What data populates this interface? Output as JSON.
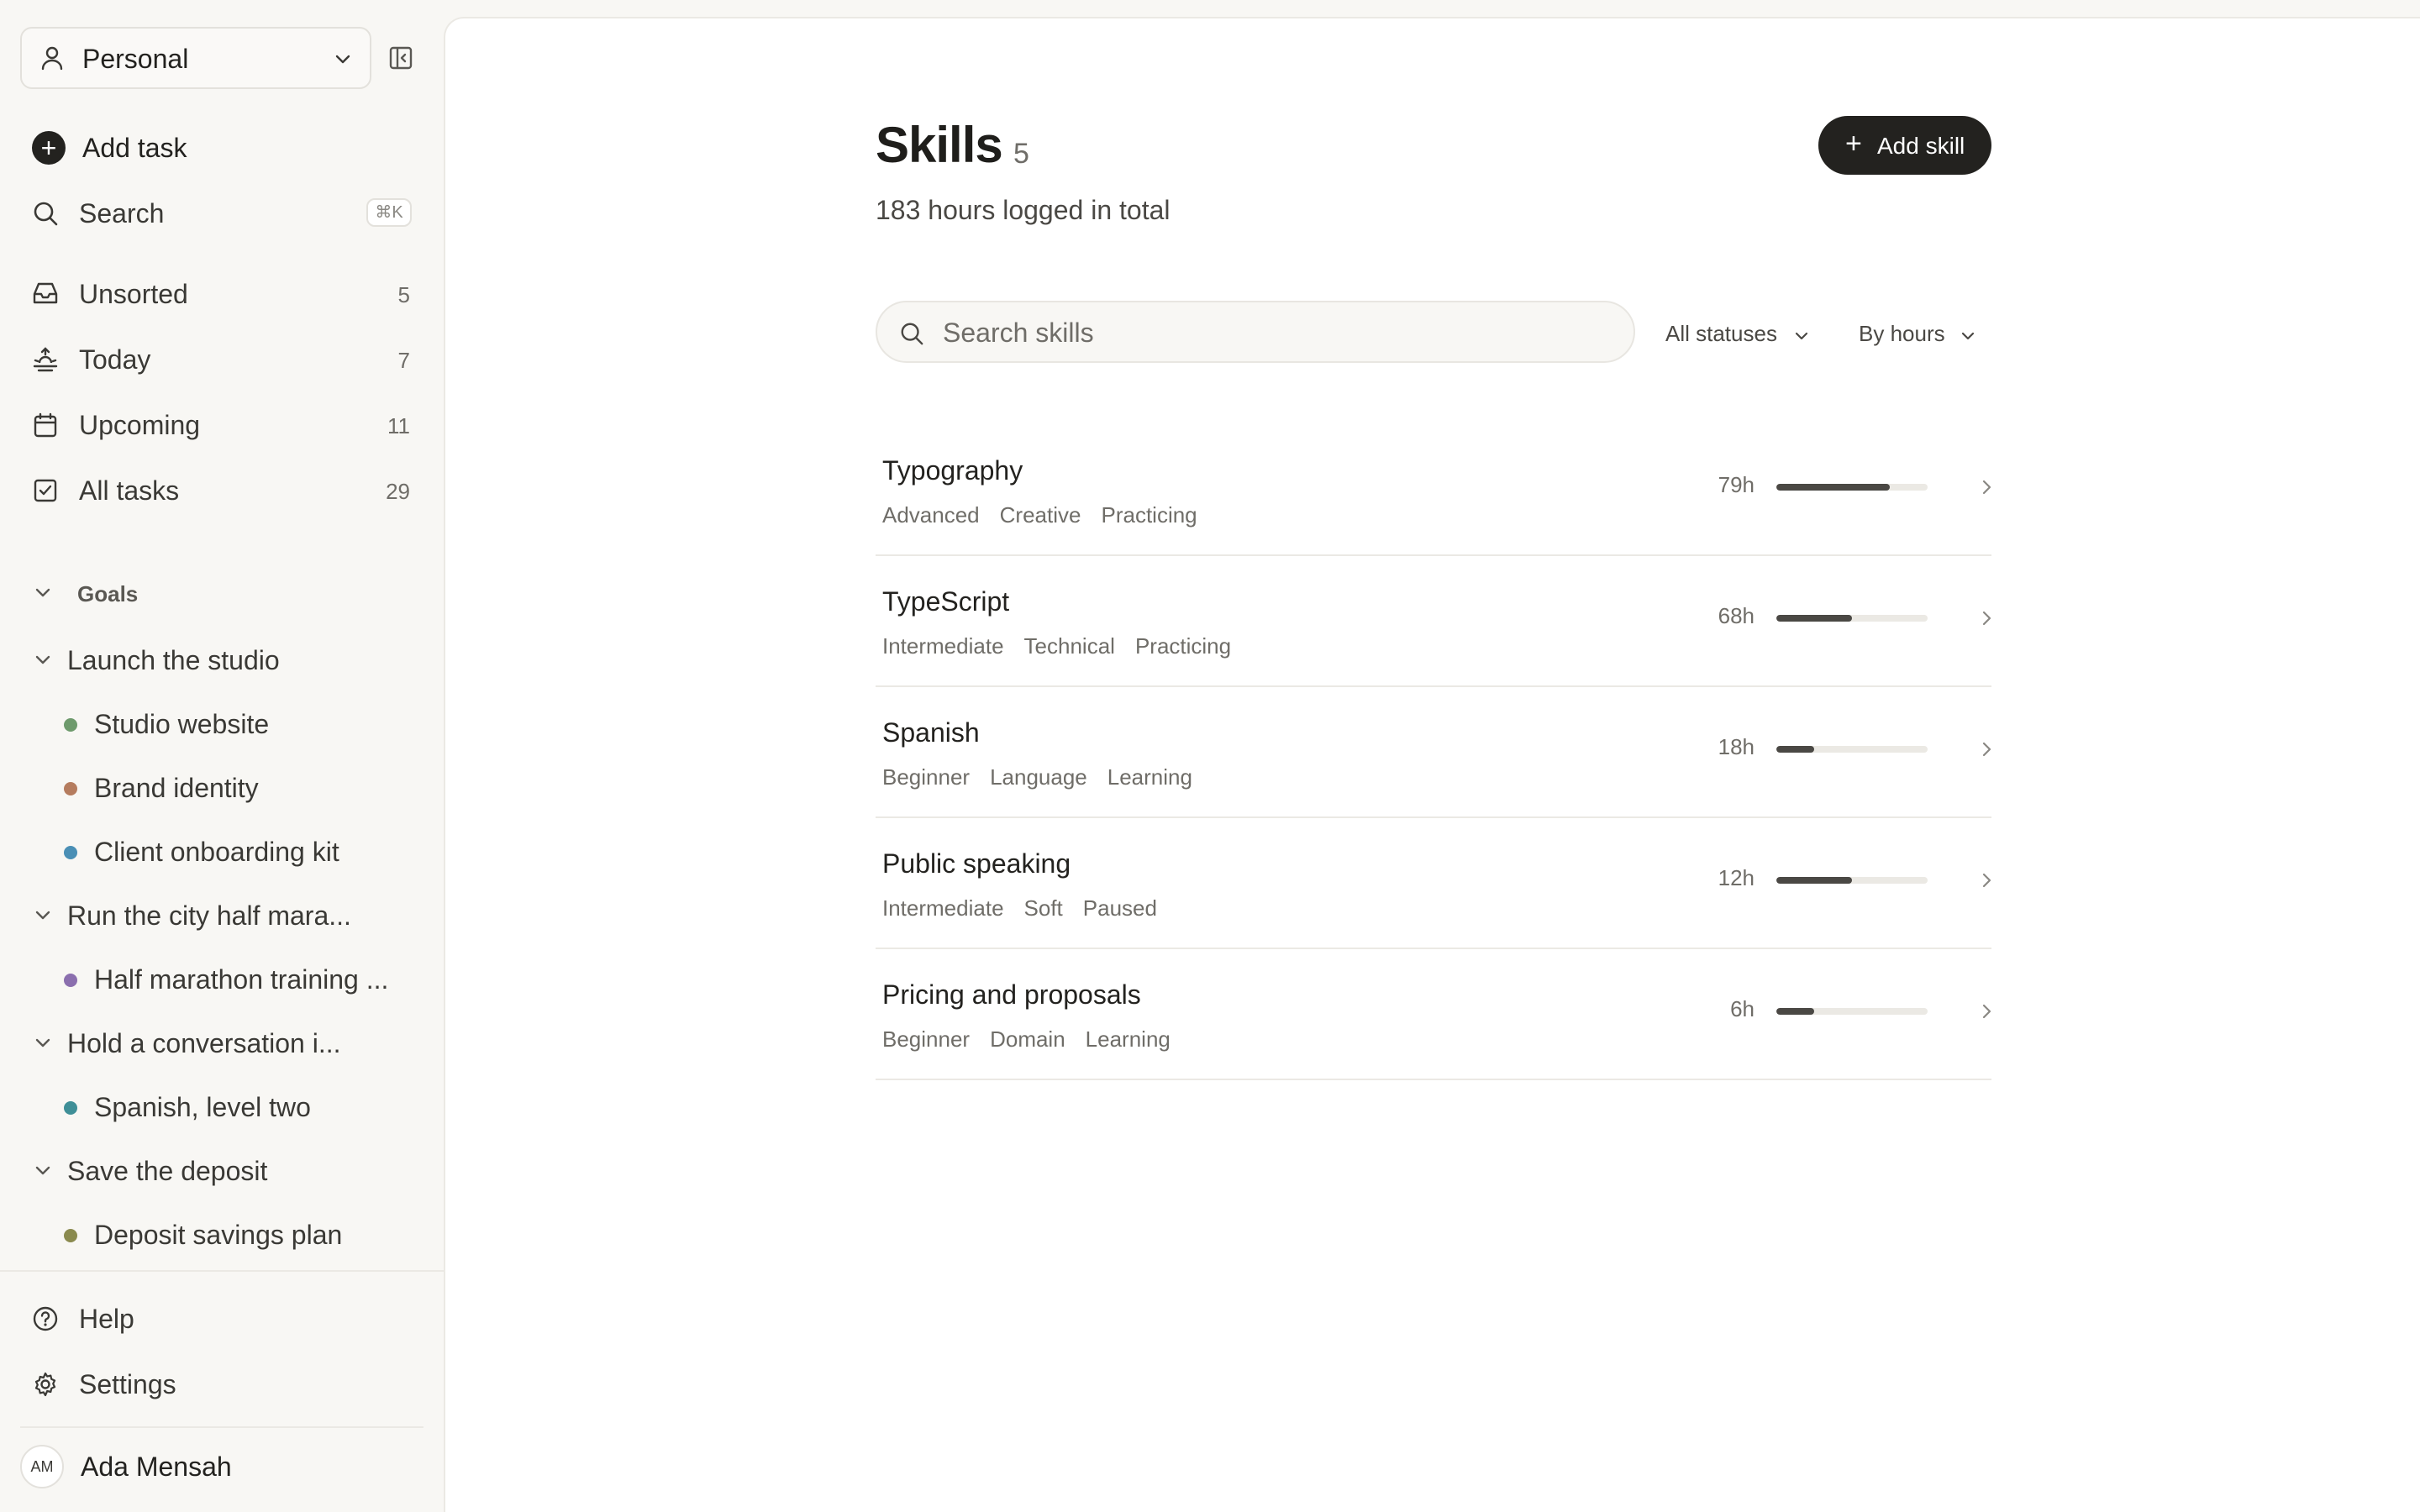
{
  "sidebar": {
    "workspace": {
      "name": "Personal"
    },
    "add_task": {
      "label": "Add task"
    },
    "search": {
      "label": "Search",
      "shortcut": "⌘K"
    },
    "nav": [
      {
        "label": "Unsorted",
        "count": "5",
        "icon": "inbox-icon"
      },
      {
        "label": "Today",
        "count": "7",
        "icon": "sunrise-icon"
      },
      {
        "label": "Upcoming",
        "count": "11",
        "icon": "calendar-icon"
      },
      {
        "label": "All tasks",
        "count": "29",
        "icon": "checkbox-icon"
      }
    ],
    "goals_header": "Goals",
    "goals": [
      {
        "label": "Launch the studio",
        "projects": [
          {
            "label": "Studio website",
            "color": "#6e9a6c"
          },
          {
            "label": "Brand identity",
            "color": "#b57c5e"
          },
          {
            "label": "Client onboarding kit",
            "color": "#4a8fb5"
          }
        ]
      },
      {
        "label": "Run the city half mara...",
        "projects": [
          {
            "label": "Half marathon training ...",
            "color": "#8b6fae"
          }
        ]
      },
      {
        "label": "Hold a conversation i...",
        "projects": [
          {
            "label": "Spanish, level two",
            "color": "#3f8f97"
          }
        ]
      },
      {
        "label": "Save the deposit",
        "projects": [
          {
            "label": "Deposit savings plan",
            "color": "#8a8a4e"
          }
        ]
      }
    ],
    "help": "Help",
    "settings": "Settings",
    "user": {
      "initials": "AM",
      "name": "Ada Mensah"
    }
  },
  "main": {
    "title": "Skills",
    "count": "5",
    "subtitle": "183 hours logged in total",
    "add_button": "Add skill",
    "search_placeholder": "Search skills",
    "filter_status": "All statuses",
    "sort": "By hours",
    "skills": [
      {
        "name": "Typography",
        "tags": [
          "Advanced",
          "Creative",
          "Practicing"
        ],
        "hours": "79h",
        "progress": 0.75
      },
      {
        "name": "TypeScript",
        "tags": [
          "Intermediate",
          "Technical",
          "Practicing"
        ],
        "hours": "68h",
        "progress": 0.5
      },
      {
        "name": "Spanish",
        "tags": [
          "Beginner",
          "Language",
          "Learning"
        ],
        "hours": "18h",
        "progress": 0.25
      },
      {
        "name": "Public speaking",
        "tags": [
          "Intermediate",
          "Soft",
          "Paused"
        ],
        "hours": "12h",
        "progress": 0.5
      },
      {
        "name": "Pricing and proposals",
        "tags": [
          "Beginner",
          "Domain",
          "Learning"
        ],
        "hours": "6h",
        "progress": 0.25
      }
    ]
  }
}
